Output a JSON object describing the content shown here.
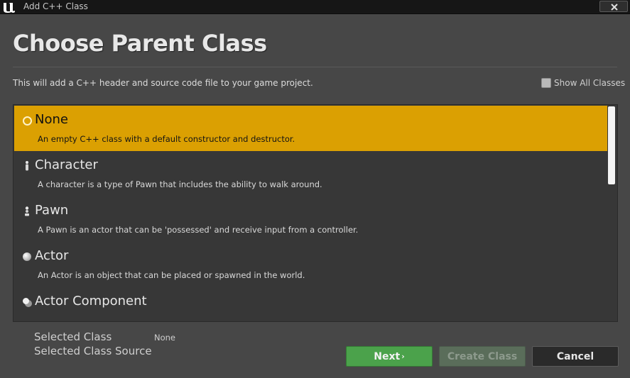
{
  "window": {
    "title": "Add C++ Class",
    "close_symbol": "✕"
  },
  "header": {
    "title": "Choose Parent Class",
    "subtitle": "This will add a C++ header and source code file to your game project.",
    "show_all_label": "Show All Classes",
    "show_all_checked": false
  },
  "classes": [
    {
      "name": "None",
      "description": "An empty C++ class with a default constructor and destructor.",
      "icon": "ring-icon",
      "selected": true
    },
    {
      "name": "Character",
      "description": "A character is a type of Pawn that includes the ability to walk around.",
      "icon": "character-icon",
      "selected": false
    },
    {
      "name": "Pawn",
      "description": "A Pawn is an actor that can be 'possessed' and receive input from a controller.",
      "icon": "pawn-icon",
      "selected": false
    },
    {
      "name": "Actor",
      "description": "An Actor is an object that can be placed or spawned in the world.",
      "icon": "sphere-icon",
      "selected": false
    },
    {
      "name": "Actor Component",
      "description": "",
      "icon": "component-icon",
      "selected": false
    }
  ],
  "footer": {
    "selected_class_label": "Selected Class",
    "selected_class_value": "None",
    "selected_class_source_label": "Selected Class Source",
    "next_label": "Next",
    "next_chevron": "›",
    "create_label": "Create Class",
    "cancel_label": "Cancel"
  },
  "colors": {
    "selection": "#dba002",
    "next_button": "#4ba24b",
    "create_button_disabled": "#5a6d5a",
    "background": "#474747"
  }
}
